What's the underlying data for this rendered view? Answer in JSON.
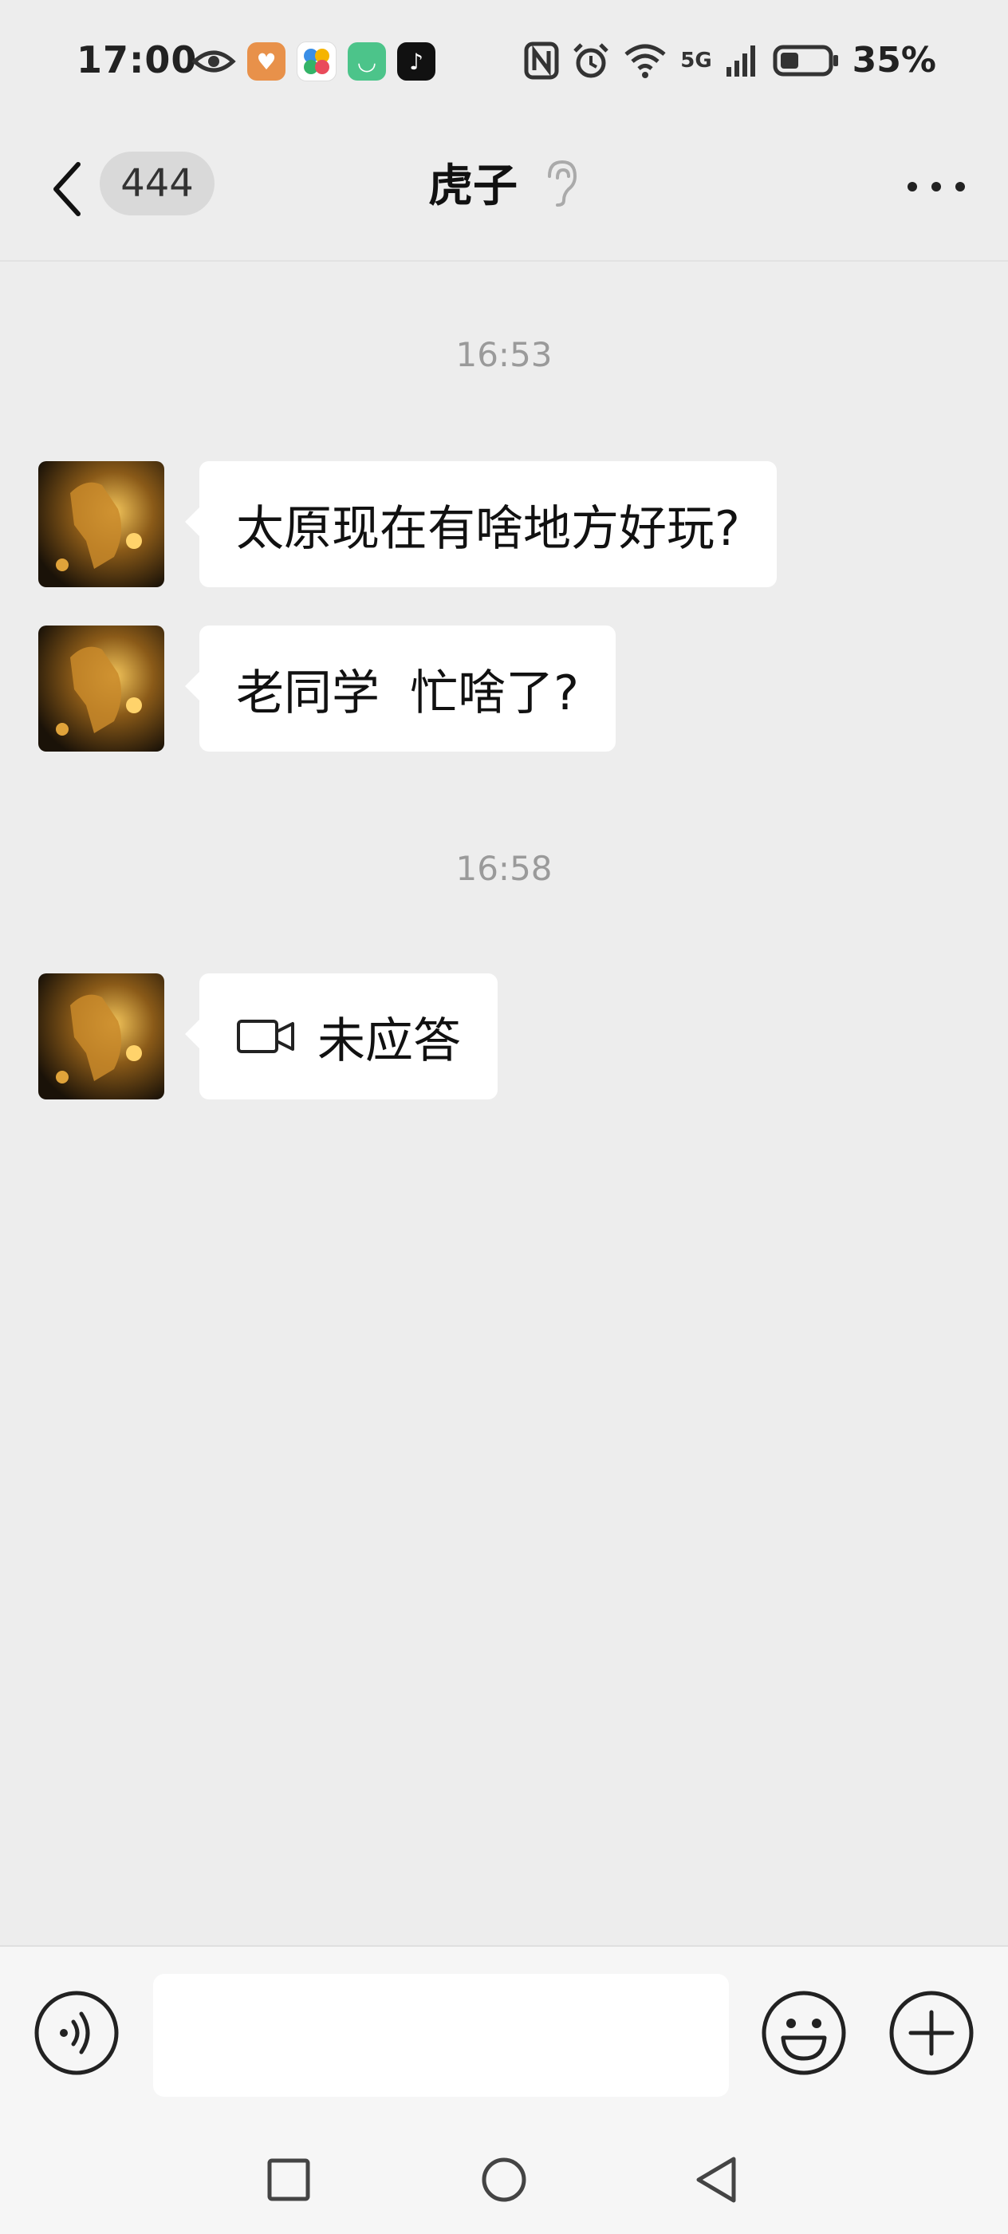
{
  "status_bar": {
    "time": "17:00",
    "battery": "35%",
    "network": "5G",
    "icons": [
      "eye-icon",
      "heart-app-icon",
      "pinwheel-app-icon",
      "mi-app-icon",
      "tiktok-icon",
      "nfc-icon",
      "alarm-icon",
      "wifi-icon",
      "signal-icon",
      "battery-icon"
    ]
  },
  "header": {
    "unread_count": "444",
    "title": "虎子"
  },
  "messages": [
    {
      "timestamp": "16:53"
    },
    {
      "text": "太原现在有啥地方好玩?"
    },
    {
      "text": "老同学  忙啥了?"
    },
    {
      "timestamp": "16:58"
    },
    {
      "text": "未应答",
      "icon": "video-call-icon"
    }
  ],
  "input": {
    "value": "",
    "placeholder": ""
  },
  "colors": {
    "background": "#ededed",
    "bubble": "#ffffff",
    "timestamp": "#9a9a9a"
  }
}
